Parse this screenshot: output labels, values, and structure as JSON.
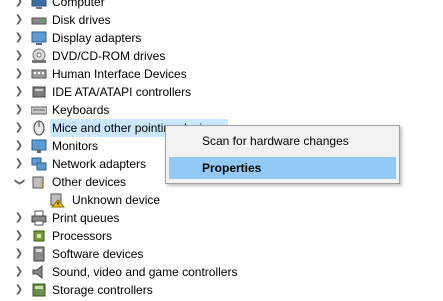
{
  "device_tree": {
    "items": [
      {
        "label": "Computer"
      },
      {
        "label": "Disk drives"
      },
      {
        "label": "Display adapters"
      },
      {
        "label": "DVD/CD-ROM drives"
      },
      {
        "label": "Human Interface Devices"
      },
      {
        "label": "IDE ATA/ATAPI controllers"
      },
      {
        "label": "Keyboards"
      },
      {
        "label": "Mice and other pointing devices"
      },
      {
        "label": "Monitors"
      },
      {
        "label": "Network adapters"
      },
      {
        "label": "Other devices"
      },
      {
        "label": "Unknown device"
      },
      {
        "label": "Print queues"
      },
      {
        "label": "Processors"
      },
      {
        "label": "Software devices"
      },
      {
        "label": "Sound, video and game controllers"
      },
      {
        "label": "Storage controllers"
      }
    ]
  },
  "context_menu": {
    "scan": "Scan for hardware changes",
    "properties": "Properties"
  },
  "colors": {
    "selection": "#cce8ff",
    "menu_highlight": "#91c9f7"
  }
}
